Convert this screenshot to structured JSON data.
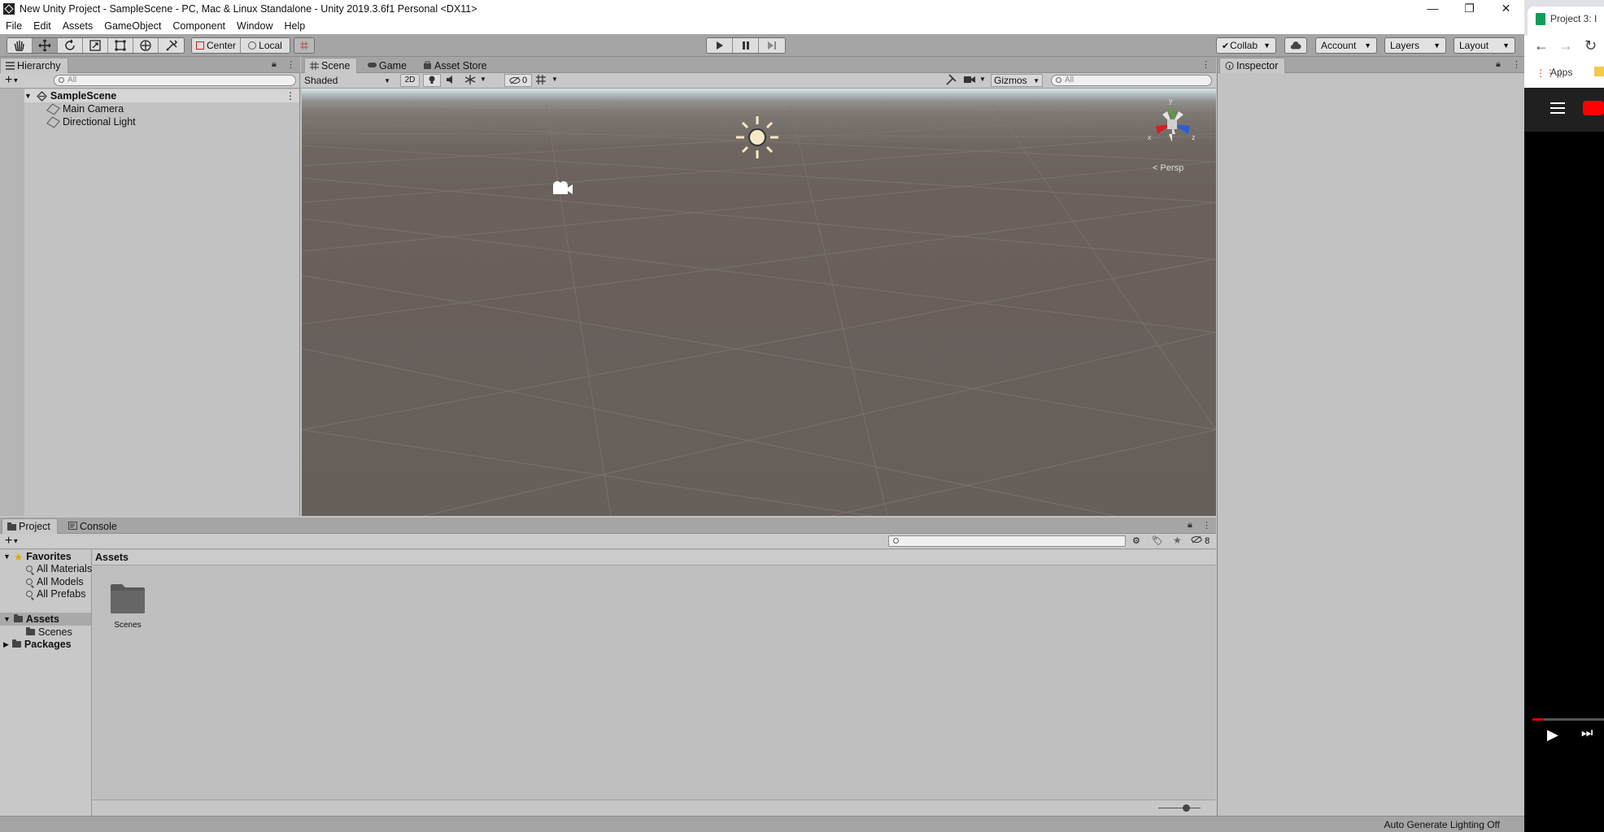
{
  "window": {
    "title": "New Unity Project - SampleScene - PC, Mac & Linux Standalone - Unity 2019.3.6f1 Personal <DX11>",
    "controls": [
      "—",
      "❐",
      "✕"
    ]
  },
  "menu": [
    "File",
    "Edit",
    "Assets",
    "GameObject",
    "Component",
    "Window",
    "Help"
  ],
  "toolbar": {
    "pivot": "Center",
    "space": "Local",
    "collab": "Collab",
    "account": "Account",
    "layers": "Layers",
    "layout": "Layout"
  },
  "hierarchy": {
    "tab": "Hierarchy",
    "search_placeholder": "All",
    "scene": "SampleScene",
    "items": [
      "Main Camera",
      "Directional Light"
    ]
  },
  "scene": {
    "tabs": [
      "Scene",
      "Game",
      "Asset Store"
    ],
    "draw_mode": "Shaded",
    "mode_2d": "2D",
    "hidden_count": "0",
    "gizmos": "Gizmos",
    "search_placeholder": "All",
    "persp": "Persp",
    "axis": {
      "x": "x",
      "y": "y",
      "z": "z"
    }
  },
  "inspector": {
    "tab": "Inspector"
  },
  "project": {
    "tabs": [
      "Project",
      "Console"
    ],
    "hidden_count": "8",
    "favorites": {
      "label": "Favorites",
      "items": [
        "All Materials",
        "All Models",
        "All Prefabs"
      ]
    },
    "assets_label": "Assets",
    "assets_children": [
      "Scenes"
    ],
    "packages_label": "Packages",
    "breadcrumb": "Assets",
    "grid_items": [
      "Scenes"
    ]
  },
  "status": {
    "text": "Auto Generate Lighting Off"
  },
  "browser": {
    "tab_title": "Project 3: I",
    "bookmarks": "Apps"
  },
  "colors": {
    "accent_red": "#e00000",
    "youtube_red": "#ff0000",
    "axis_x": "#d42020",
    "axis_y": "#4caf26",
    "axis_z": "#2e5ed6"
  }
}
